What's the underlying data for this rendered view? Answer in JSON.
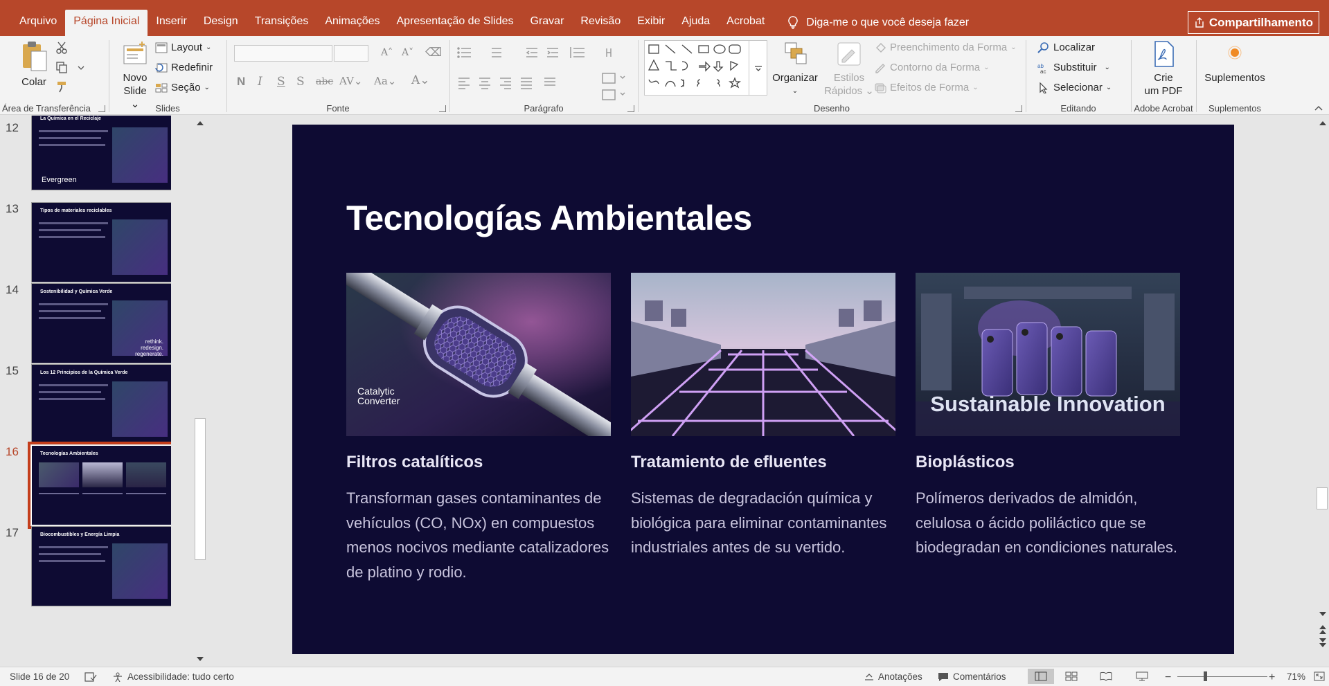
{
  "menu": {
    "tabs": [
      "Arquivo",
      "Página Inicial",
      "Inserir",
      "Design",
      "Transições",
      "Animações",
      "Apresentação de Slides",
      "Gravar",
      "Revisão",
      "Exibir",
      "Ajuda",
      "Acrobat"
    ],
    "active_tab": "Página Inicial",
    "tell_me": "Diga-me o que você deseja fazer",
    "share": "Compartilhamento"
  },
  "ribbon": {
    "clipboard": {
      "label": "Área de Transferência",
      "paste": "Colar"
    },
    "slides": {
      "label": "Slides",
      "new_slide_line1": "Novo",
      "new_slide_line2": "Slide",
      "layout": "Layout",
      "reset": "Redefinir",
      "section": "Seção"
    },
    "font": {
      "label": "Fonte"
    },
    "paragraph": {
      "label": "Parágrafo"
    },
    "drawing": {
      "label": "Desenho",
      "arrange": "Organizar",
      "quick_styles_line1": "Estilos",
      "quick_styles_line2": "Rápidos",
      "shape_fill": "Preenchimento da Forma",
      "shape_outline": "Contorno da Forma",
      "shape_effects": "Efeitos de Forma"
    },
    "editing": {
      "label": "Editando",
      "find": "Localizar",
      "replace": "Substituir",
      "select": "Selecionar"
    },
    "acrobat": {
      "label": "Adobe Acrobat",
      "create_pdf_line1": "Crie",
      "create_pdf_line2": "um PDF"
    },
    "addins": {
      "label": "Suplementos",
      "button": "Suplementos"
    }
  },
  "thumbnails": [
    {
      "num": "12",
      "title": "La Química en el Reciclaje",
      "badge": "Evergreen"
    },
    {
      "num": "13",
      "title": "Tipos de materiales reciclables"
    },
    {
      "num": "14",
      "title": "Sostenibilidad y Química Verde",
      "caption": "rethink. redesign. regenerate."
    },
    {
      "num": "15",
      "title": "Los 12 Principios de la Química Verde"
    },
    {
      "num": "16",
      "title": "Tecnologías Ambientales",
      "active": true
    },
    {
      "num": "17",
      "title": "Biocombustibles y Energía Limpia"
    }
  ],
  "slide": {
    "title": "Tecnologías Ambientales",
    "cards": [
      {
        "image_label_line1": "Catalytic",
        "image_label_line2": "Converter",
        "title": "Filtros catalíticos",
        "body": "Transforman gases contaminantes de vehículos (CO, NOx) en compuestos menos nocivos mediante catalizadores de platino y rodio."
      },
      {
        "image_label": "",
        "title": "Tratamiento de efluentes",
        "body": "Sistemas de degradación química y biológica para eliminar contaminantes industriales antes de su vertido."
      },
      {
        "image_label": "Sustainable Innovation",
        "title": "Bioplásticos",
        "body": "Polímeros derivados de almidón, celulosa o ácido poliláctico que se biodegradan en condiciones naturales."
      }
    ]
  },
  "status": {
    "slide_info": "Slide 16 de 20",
    "accessibility": "Acessibilidade: tudo certo",
    "notes": "Anotações",
    "comments": "Comentários",
    "zoom": "71%"
  },
  "colors": {
    "brand": "#b7472a",
    "slide_bg": "#0e0b33",
    "accent_purple": "#9a6bff"
  }
}
